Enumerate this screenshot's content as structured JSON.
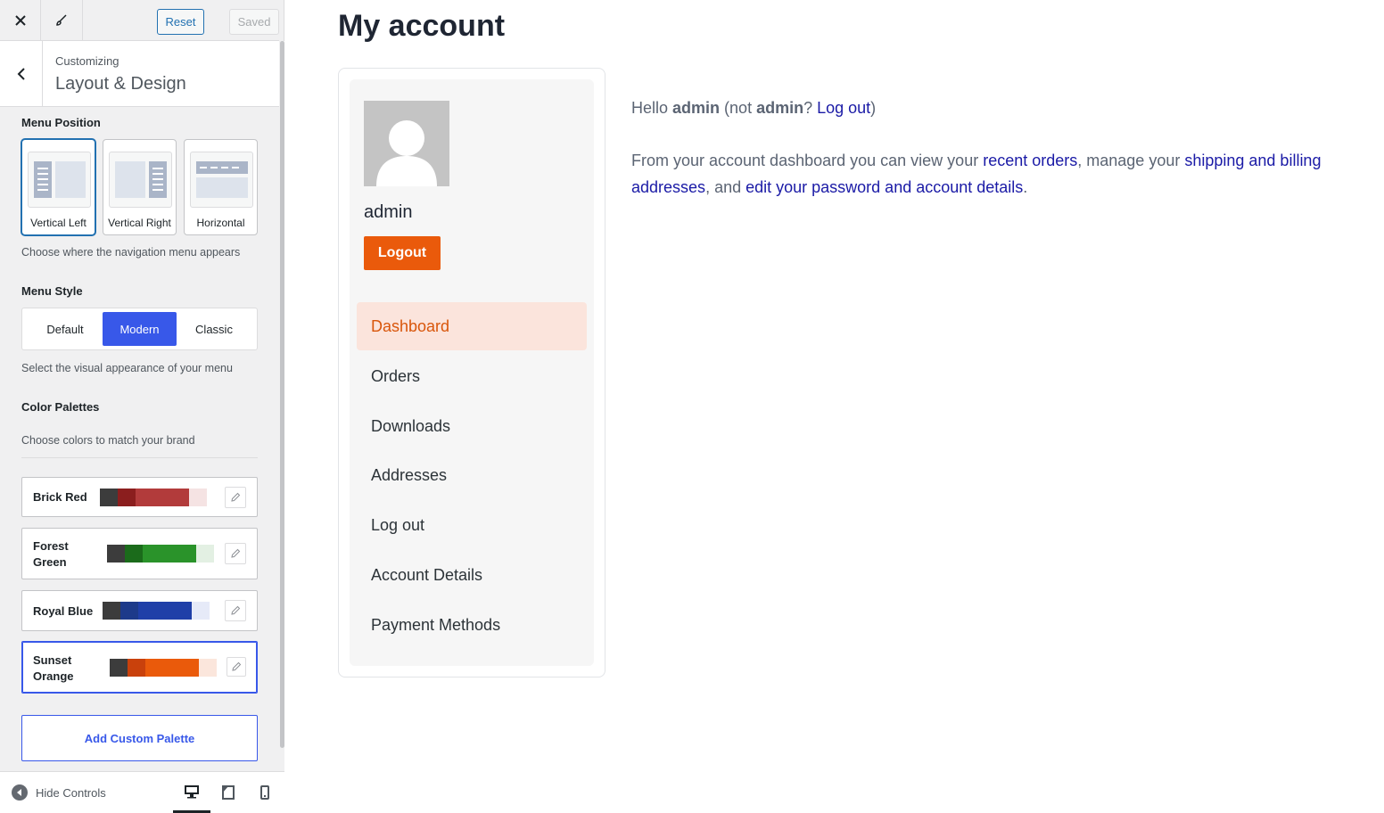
{
  "topbar": {
    "close_icon": "close-icon",
    "brush_icon": "brush-icon",
    "reset_label": "Reset",
    "saved_label": "Saved"
  },
  "section": {
    "subtitle": "Customizing",
    "title": "Layout & Design"
  },
  "menu_position": {
    "heading": "Menu Position",
    "options": [
      {
        "label": "Vertical Left",
        "selected": true
      },
      {
        "label": "Vertical Right",
        "selected": false
      },
      {
        "label": "Horizontal",
        "selected": false
      }
    ],
    "description": "Choose where the navigation menu appears"
  },
  "menu_style": {
    "heading": "Menu Style",
    "options": [
      "Default",
      "Modern",
      "Classic"
    ],
    "selected": "Modern",
    "description": "Select the visual appearance of your menu"
  },
  "color_palettes": {
    "heading": "Color Palettes",
    "description": "Choose colors to match your brand",
    "palettes": [
      {
        "name": "Brick Red",
        "colors": [
          "#3c3c3c",
          "#8b1e1e",
          "#b23b3b",
          "#f5e3e3"
        ],
        "selected": false
      },
      {
        "name": "Forest Green",
        "colors": [
          "#3c3c3c",
          "#1b6b1b",
          "#2a932a",
          "#e3f0e3"
        ],
        "selected": false
      },
      {
        "name": "Royal Blue",
        "colors": [
          "#3c3c3c",
          "#1d3a8a",
          "#1f3fa8",
          "#e6eaf8"
        ],
        "selected": false
      },
      {
        "name": "Sunset Orange",
        "colors": [
          "#3c3c3c",
          "#c9410c",
          "#ea5a0b",
          "#fbe6dc"
        ],
        "selected": true
      }
    ],
    "add_label": "Add Custom Palette"
  },
  "footer": {
    "hide_label": "Hide Controls",
    "devices": [
      "desktop",
      "tablet",
      "mobile"
    ],
    "active_device": "desktop"
  },
  "preview": {
    "title": "My account",
    "user": "admin",
    "logout_label": "Logout",
    "nav": [
      "Dashboard",
      "Orders",
      "Downloads",
      "Addresses",
      "Log out",
      "Account Details",
      "Payment Methods"
    ],
    "active_nav": "Dashboard",
    "hello": {
      "p1": "Hello ",
      "name": "admin",
      "p2": " (not ",
      "name2": "admin",
      "p3": "? ",
      "logout_link": "Log out",
      "p4": ")"
    },
    "dashboard": {
      "p1": "From your account dashboard you can view your ",
      "link1": "recent orders",
      "p2": ", manage your ",
      "link2": "shipping and billing addresses",
      "p3": ", and ",
      "link3": "edit your password and account details",
      "p4": "."
    },
    "colors": {
      "accent": "#ea5a0b",
      "link": "#1a1aa6",
      "text": "#5b6473"
    }
  }
}
